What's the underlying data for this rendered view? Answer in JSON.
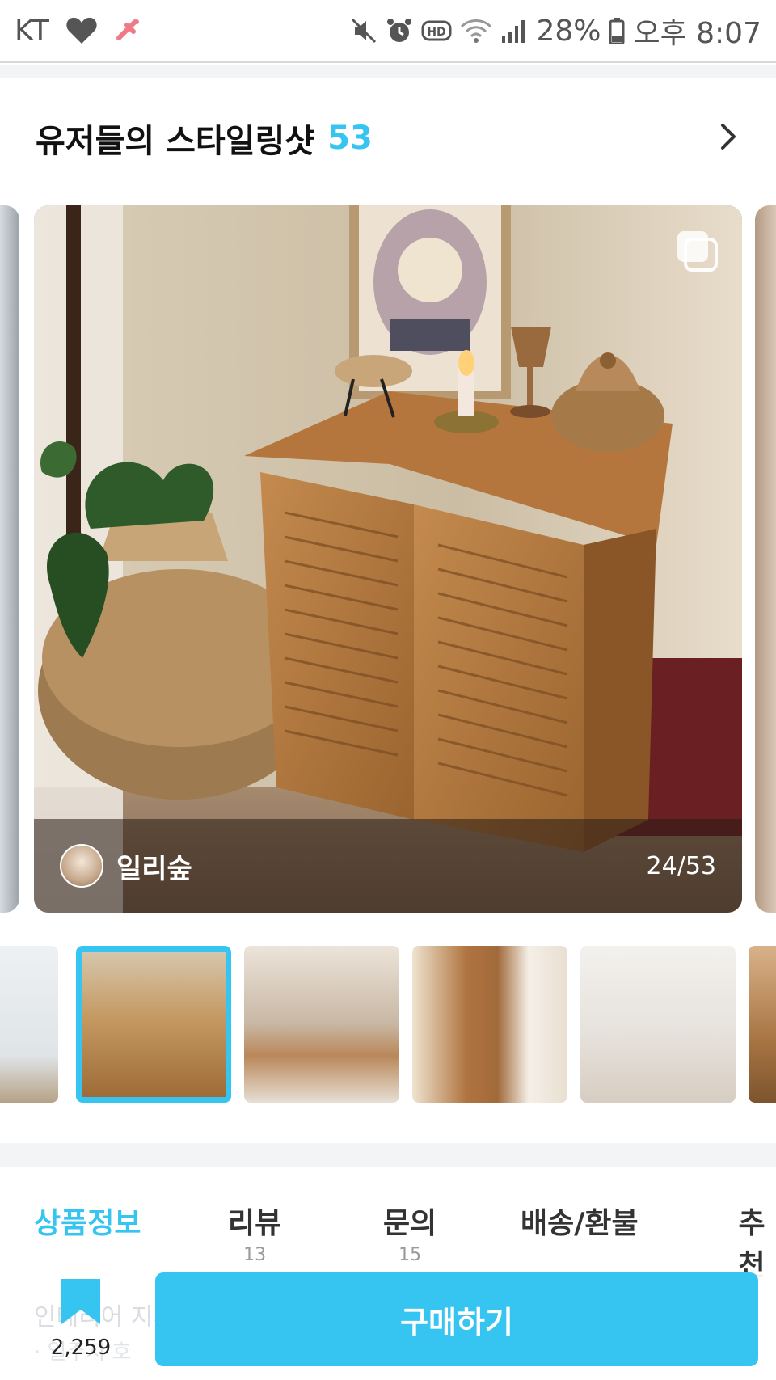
{
  "status_bar": {
    "carrier": "KT",
    "battery": "28%",
    "time": "오후 8:07",
    "icons": [
      "heart-icon",
      "notification-icon",
      "mute-icon",
      "alarm-icon",
      "hd-icon",
      "wifi-icon",
      "signal-icon",
      "battery-icon"
    ]
  },
  "styling_section": {
    "title": "유저들의 스타일링샷",
    "count": "53"
  },
  "main_photo": {
    "author": "일리숲",
    "counter": "24/53"
  },
  "tabs": [
    {
      "label": "상품정보",
      "count": ""
    },
    {
      "label": "리뷰",
      "count": "13"
    },
    {
      "label": "문의",
      "count": "15"
    },
    {
      "label": "배송/환불",
      "count": ""
    },
    {
      "label": "추천",
      "count": ""
    }
  ],
  "bottom_bar": {
    "bookmark_count": "2,259",
    "buy_label": "구매하기",
    "faded_line1": "인테리어 지시",
    "faded_line2": "· 일주지 호"
  },
  "colors": {
    "accent": "#35c5f0"
  }
}
